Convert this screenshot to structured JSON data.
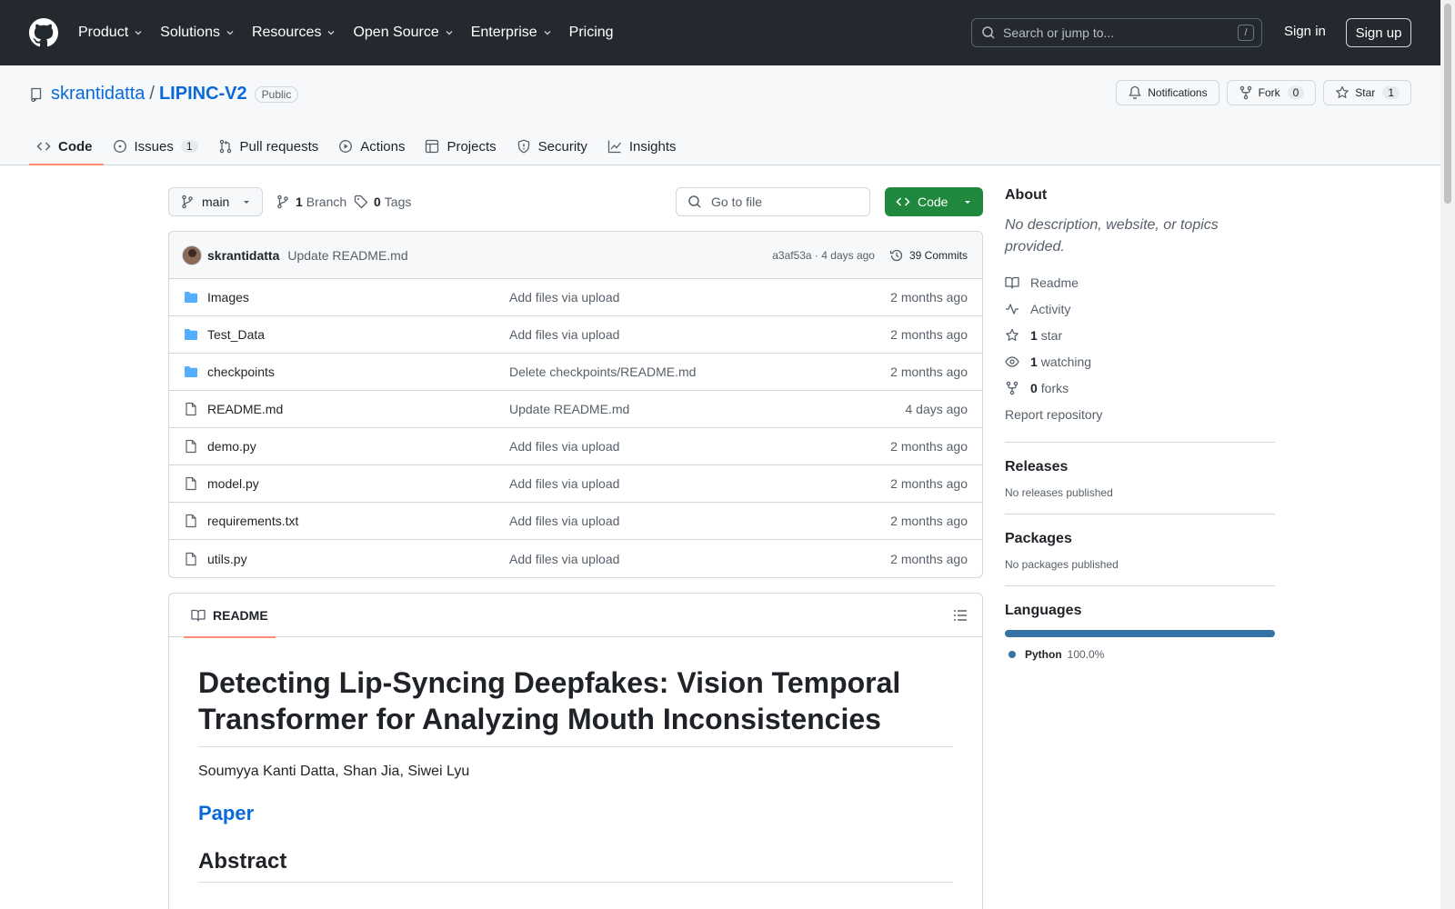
{
  "topnav": {
    "items": [
      "Product",
      "Solutions",
      "Resources",
      "Open Source",
      "Enterprise",
      "Pricing"
    ],
    "search_placeholder": "Search or jump to...",
    "search_key": "/",
    "signin": "Sign in",
    "signup": "Sign up"
  },
  "repo": {
    "owner": "skrantidatta",
    "separator": "/",
    "name": "LIPINC-V2",
    "visibility": "Public",
    "notifications_label": "Notifications",
    "fork_label": "Fork",
    "fork_count": "0",
    "star_label": "Star",
    "star_count": "1"
  },
  "tabs": {
    "code": "Code",
    "issues": "Issues",
    "issues_count": "1",
    "pulls": "Pull requests",
    "actions": "Actions",
    "projects": "Projects",
    "security": "Security",
    "insights": "Insights"
  },
  "toolbar": {
    "branch": "main",
    "branch_count": "1",
    "branch_label": "Branch",
    "tag_count": "0",
    "tag_label": "Tags",
    "goto_file": "Go to file",
    "code_button": "Code"
  },
  "commit": {
    "author": "skrantidatta",
    "message": "Update README.md",
    "sha_time": "a3af53a · 4 days ago",
    "commits_label": "39 Commits"
  },
  "files": [
    {
      "name": "Images",
      "type": "dir",
      "message": "Add files via upload",
      "date": "2 months ago"
    },
    {
      "name": "Test_Data",
      "type": "dir",
      "message": "Add files via upload",
      "date": "2 months ago"
    },
    {
      "name": "checkpoints",
      "type": "dir",
      "message": "Delete checkpoints/README.md",
      "date": "2 months ago"
    },
    {
      "name": "README.md",
      "type": "file",
      "message": "Update README.md",
      "date": "4 days ago"
    },
    {
      "name": "demo.py",
      "type": "file",
      "message": "Add files via upload",
      "date": "2 months ago"
    },
    {
      "name": "model.py",
      "type": "file",
      "message": "Add files via upload",
      "date": "2 months ago"
    },
    {
      "name": "requirements.txt",
      "type": "file",
      "message": "Add files via upload",
      "date": "2 months ago"
    },
    {
      "name": "utils.py",
      "type": "file",
      "message": "Add files via upload",
      "date": "2 months ago"
    }
  ],
  "readme": {
    "tab_label": "README",
    "title": "Detecting Lip-Syncing Deepfakes: Vision Temporal Transformer for Analyzing Mouth Inconsistencies",
    "authors": "Soumyya Kanti Datta, Shan Jia, Siwei Lyu",
    "paper_link": "Paper",
    "abstract_heading": "Abstract"
  },
  "sidebar": {
    "about_heading": "About",
    "about_desc": "No description, website, or topics provided.",
    "readme": "Readme",
    "activity": "Activity",
    "stars_count": "1",
    "stars_label": "star",
    "watching_count": "1",
    "watching_label": "watching",
    "forks_count": "0",
    "forks_label": "forks",
    "report": "Report repository",
    "releases_heading": "Releases",
    "releases_text": "No releases published",
    "packages_heading": "Packages",
    "packages_text": "No packages published",
    "languages_heading": "Languages",
    "language_name": "Python",
    "language_pct": "100.0%",
    "language_color": "#3572a5"
  }
}
